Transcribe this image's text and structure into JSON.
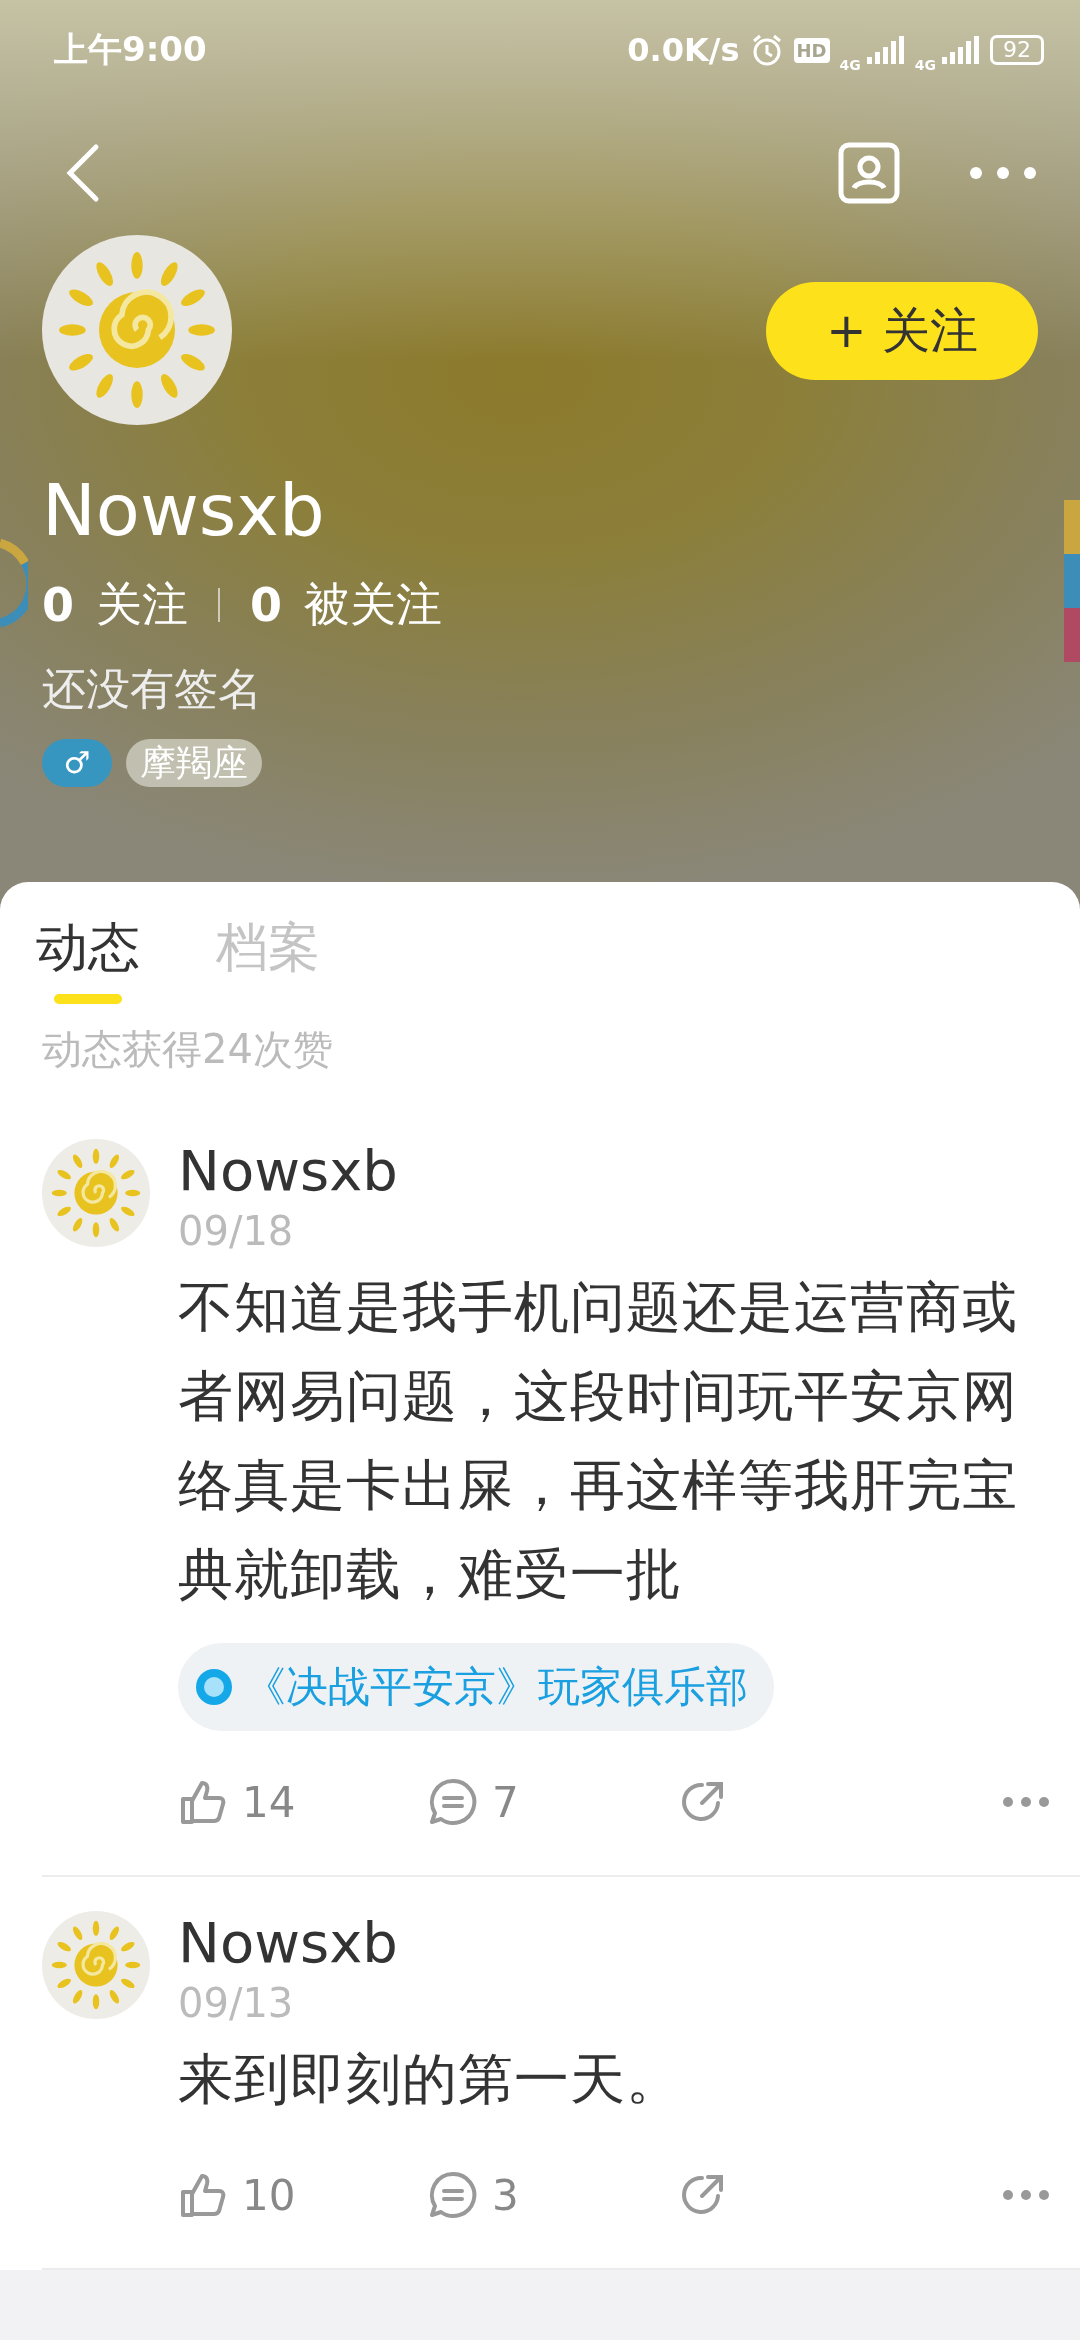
{
  "status_bar": {
    "time": "上午9:00",
    "speed": "0.0K/s",
    "hd": "HD",
    "network_1": "4G",
    "network_2": "4G",
    "battery": "92"
  },
  "profile": {
    "name": "Nowsxb",
    "following_count": "0",
    "following_label": "关注",
    "followers_count": "0",
    "followers_label": "被关注",
    "signature": "还没有签名",
    "gender": "♂",
    "tag": "摩羯座",
    "follow_button": "+ 关注"
  },
  "tabs": [
    {
      "label": "动态",
      "selected": true
    },
    {
      "label": "档案",
      "selected": false
    }
  ],
  "likes_summary": "动态获得24次赞",
  "posts": [
    {
      "author": "Nowsxb",
      "date": "09/18",
      "text": "不知道是我手机问题还是运营商或者网易问题，这段时间玩平安京网络真是卡出屎，再这样等我肝完宝典就卸载，难受一批",
      "club": "《决战平安京》玩家俱乐部",
      "likes": "14",
      "comments": "7"
    },
    {
      "author": "Nowsxb",
      "date": "09/13",
      "text": "来到即刻的第一天。",
      "likes": "10",
      "comments": "3"
    }
  ]
}
